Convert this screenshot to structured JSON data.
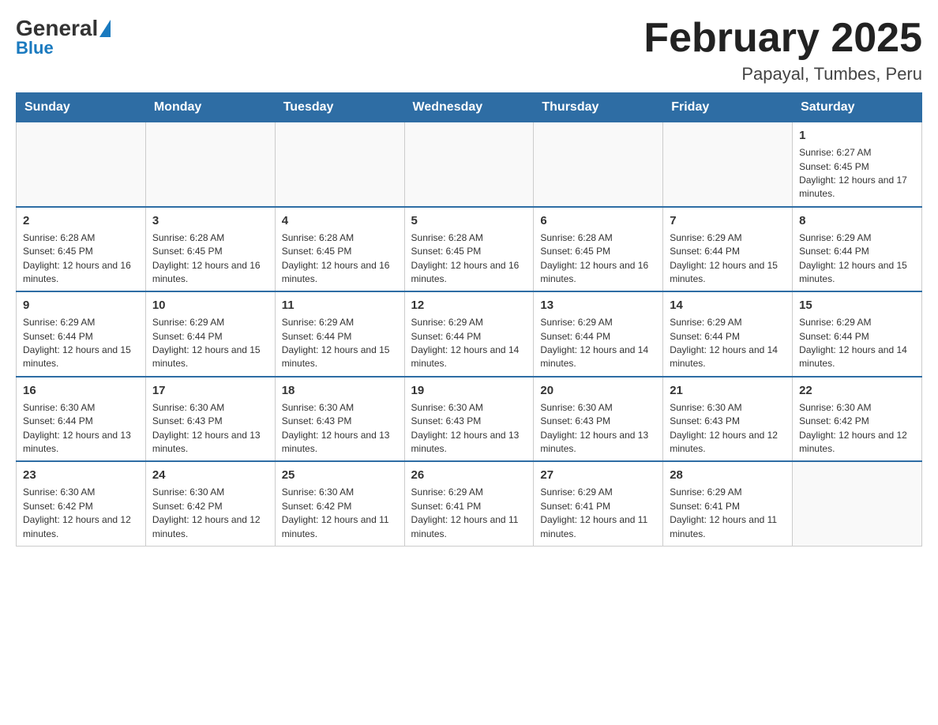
{
  "header": {
    "logo_general": "General",
    "logo_blue": "Blue",
    "month_title": "February 2025",
    "location": "Papayal, Tumbes, Peru"
  },
  "days_of_week": [
    "Sunday",
    "Monday",
    "Tuesday",
    "Wednesday",
    "Thursday",
    "Friday",
    "Saturday"
  ],
  "weeks": [
    [
      {
        "day": "",
        "info": ""
      },
      {
        "day": "",
        "info": ""
      },
      {
        "day": "",
        "info": ""
      },
      {
        "day": "",
        "info": ""
      },
      {
        "day": "",
        "info": ""
      },
      {
        "day": "",
        "info": ""
      },
      {
        "day": "1",
        "info": "Sunrise: 6:27 AM\nSunset: 6:45 PM\nDaylight: 12 hours and 17 minutes."
      }
    ],
    [
      {
        "day": "2",
        "info": "Sunrise: 6:28 AM\nSunset: 6:45 PM\nDaylight: 12 hours and 16 minutes."
      },
      {
        "day": "3",
        "info": "Sunrise: 6:28 AM\nSunset: 6:45 PM\nDaylight: 12 hours and 16 minutes."
      },
      {
        "day": "4",
        "info": "Sunrise: 6:28 AM\nSunset: 6:45 PM\nDaylight: 12 hours and 16 minutes."
      },
      {
        "day": "5",
        "info": "Sunrise: 6:28 AM\nSunset: 6:45 PM\nDaylight: 12 hours and 16 minutes."
      },
      {
        "day": "6",
        "info": "Sunrise: 6:28 AM\nSunset: 6:45 PM\nDaylight: 12 hours and 16 minutes."
      },
      {
        "day": "7",
        "info": "Sunrise: 6:29 AM\nSunset: 6:44 PM\nDaylight: 12 hours and 15 minutes."
      },
      {
        "day": "8",
        "info": "Sunrise: 6:29 AM\nSunset: 6:44 PM\nDaylight: 12 hours and 15 minutes."
      }
    ],
    [
      {
        "day": "9",
        "info": "Sunrise: 6:29 AM\nSunset: 6:44 PM\nDaylight: 12 hours and 15 minutes."
      },
      {
        "day": "10",
        "info": "Sunrise: 6:29 AM\nSunset: 6:44 PM\nDaylight: 12 hours and 15 minutes."
      },
      {
        "day": "11",
        "info": "Sunrise: 6:29 AM\nSunset: 6:44 PM\nDaylight: 12 hours and 15 minutes."
      },
      {
        "day": "12",
        "info": "Sunrise: 6:29 AM\nSunset: 6:44 PM\nDaylight: 12 hours and 14 minutes."
      },
      {
        "day": "13",
        "info": "Sunrise: 6:29 AM\nSunset: 6:44 PM\nDaylight: 12 hours and 14 minutes."
      },
      {
        "day": "14",
        "info": "Sunrise: 6:29 AM\nSunset: 6:44 PM\nDaylight: 12 hours and 14 minutes."
      },
      {
        "day": "15",
        "info": "Sunrise: 6:29 AM\nSunset: 6:44 PM\nDaylight: 12 hours and 14 minutes."
      }
    ],
    [
      {
        "day": "16",
        "info": "Sunrise: 6:30 AM\nSunset: 6:44 PM\nDaylight: 12 hours and 13 minutes."
      },
      {
        "day": "17",
        "info": "Sunrise: 6:30 AM\nSunset: 6:43 PM\nDaylight: 12 hours and 13 minutes."
      },
      {
        "day": "18",
        "info": "Sunrise: 6:30 AM\nSunset: 6:43 PM\nDaylight: 12 hours and 13 minutes."
      },
      {
        "day": "19",
        "info": "Sunrise: 6:30 AM\nSunset: 6:43 PM\nDaylight: 12 hours and 13 minutes."
      },
      {
        "day": "20",
        "info": "Sunrise: 6:30 AM\nSunset: 6:43 PM\nDaylight: 12 hours and 13 minutes."
      },
      {
        "day": "21",
        "info": "Sunrise: 6:30 AM\nSunset: 6:43 PM\nDaylight: 12 hours and 12 minutes."
      },
      {
        "day": "22",
        "info": "Sunrise: 6:30 AM\nSunset: 6:42 PM\nDaylight: 12 hours and 12 minutes."
      }
    ],
    [
      {
        "day": "23",
        "info": "Sunrise: 6:30 AM\nSunset: 6:42 PM\nDaylight: 12 hours and 12 minutes."
      },
      {
        "day": "24",
        "info": "Sunrise: 6:30 AM\nSunset: 6:42 PM\nDaylight: 12 hours and 12 minutes."
      },
      {
        "day": "25",
        "info": "Sunrise: 6:30 AM\nSunset: 6:42 PM\nDaylight: 12 hours and 11 minutes."
      },
      {
        "day": "26",
        "info": "Sunrise: 6:29 AM\nSunset: 6:41 PM\nDaylight: 12 hours and 11 minutes."
      },
      {
        "day": "27",
        "info": "Sunrise: 6:29 AM\nSunset: 6:41 PM\nDaylight: 12 hours and 11 minutes."
      },
      {
        "day": "28",
        "info": "Sunrise: 6:29 AM\nSunset: 6:41 PM\nDaylight: 12 hours and 11 minutes."
      },
      {
        "day": "",
        "info": ""
      }
    ]
  ]
}
